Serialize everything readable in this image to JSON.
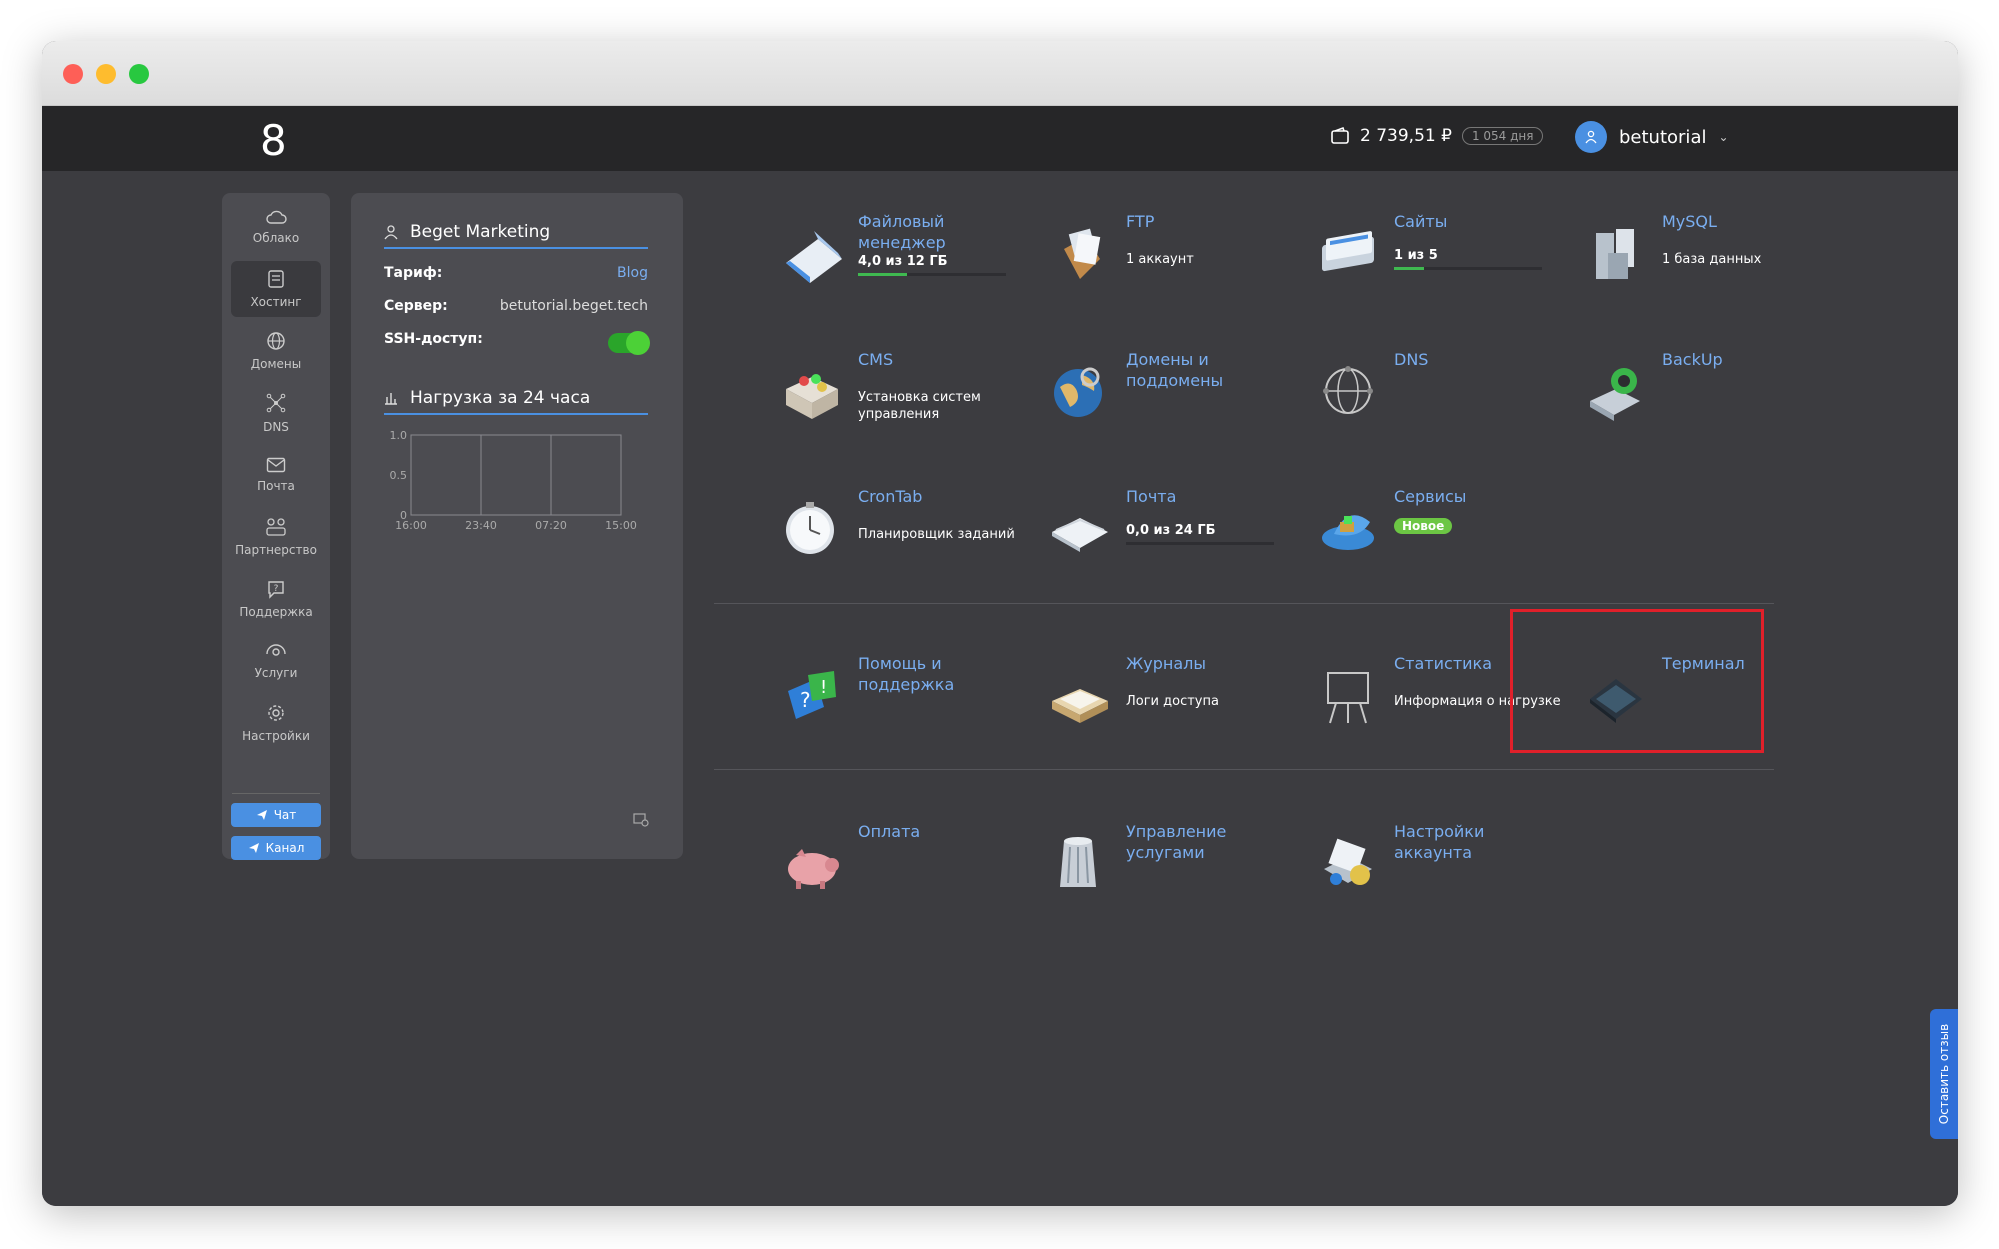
{
  "window": {
    "traffic_lights": [
      "close",
      "minimize",
      "maximize"
    ]
  },
  "topbar": {
    "logo": "8",
    "balance": "2 739,51 ₽",
    "days": "1 054 дня",
    "username": "betutorial"
  },
  "sidebar": {
    "items": [
      {
        "label": "Облако",
        "icon": "cloud-icon"
      },
      {
        "label": "Хостинг",
        "icon": "server-icon"
      },
      {
        "label": "Домены",
        "icon": "globe-icon"
      },
      {
        "label": "DNS",
        "icon": "network-icon"
      },
      {
        "label": "Почта",
        "icon": "mail-icon"
      },
      {
        "label": "Партнерство",
        "icon": "partners-icon"
      },
      {
        "label": "Поддержка",
        "icon": "support-icon"
      },
      {
        "label": "Услуги",
        "icon": "services-icon"
      },
      {
        "label": "Настройки",
        "icon": "gear-icon"
      }
    ],
    "chat_label": "Чат",
    "channel_label": "Канал"
  },
  "info": {
    "account_name": "Beget Marketing",
    "tariff_label": "Тариф:",
    "tariff_value": "Blog",
    "server_label": "Сервер:",
    "server_value": "betutorial.beget.tech",
    "ssh_label": "SSH-доступ:",
    "ssh_enabled": true,
    "load_title": "Нагрузка за 24 часа"
  },
  "chart_data": {
    "type": "line",
    "title": "Нагрузка за 24 часа",
    "x": [
      "16:00",
      "23:40",
      "07:20",
      "15:00"
    ],
    "yticks": [
      "1.0",
      "0.5",
      "0"
    ],
    "ylim": [
      0,
      1
    ],
    "series": [],
    "grid": true
  },
  "tiles": [
    {
      "id": "file-manager",
      "title": "Файловый менеджер",
      "sub": "4,0 из 12 ГБ",
      "progress": 0.33
    },
    {
      "id": "ftp",
      "title": "FTP",
      "sub": "1 аккаунт"
    },
    {
      "id": "sites",
      "title": "Сайты",
      "sub": "1 из 5",
      "progress": 0.2
    },
    {
      "id": "mysql",
      "title": "MySQL",
      "sub": "1 база данных"
    },
    {
      "id": "cms",
      "title": "CMS",
      "sub": "Установка систем управления"
    },
    {
      "id": "domains",
      "title": "Домены и поддомены",
      "sub": ""
    },
    {
      "id": "dns",
      "title": "DNS",
      "sub": ""
    },
    {
      "id": "backup",
      "title": "BackUp",
      "sub": ""
    },
    {
      "id": "crontab",
      "title": "CronTab",
      "sub": "Планировщик заданий"
    },
    {
      "id": "mail",
      "title": "Почта",
      "sub": "0,0 из 24 ГБ",
      "progress": 0.0
    },
    {
      "id": "services",
      "title": "Сервисы",
      "badge": "Новое"
    },
    {
      "id": "help",
      "title": "Помощь и поддержка",
      "sub": ""
    },
    {
      "id": "logs",
      "title": "Журналы",
      "sub": "Логи доступа"
    },
    {
      "id": "stats",
      "title": "Статистика",
      "sub": "Информация о нагрузке"
    },
    {
      "id": "terminal",
      "title": "Терминал",
      "sub": ""
    },
    {
      "id": "payment",
      "title": "Оплата",
      "sub": ""
    },
    {
      "id": "service-management",
      "title": "Управление услугами",
      "sub": ""
    },
    {
      "id": "account-settings",
      "title": "Настройки аккаунта",
      "sub": ""
    }
  ],
  "feedback_label": "Оставить отзыв",
  "colors": {
    "accent": "#4a90e2",
    "link": "#7aaef0",
    "highlight": "#e0202a",
    "toggle_on": "#4cd137"
  }
}
